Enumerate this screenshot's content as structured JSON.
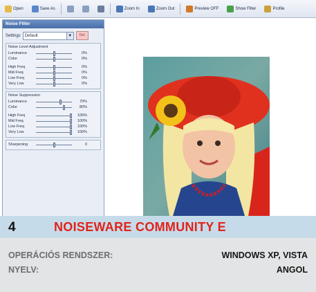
{
  "toolbar": {
    "buttons": [
      {
        "label": "Open",
        "icon": "folder-icon"
      },
      {
        "label": "Save As",
        "icon": "save-icon"
      },
      {
        "label": "",
        "icon": "copy-icon"
      },
      {
        "label": "",
        "icon": "clipboard-icon"
      },
      {
        "label": "",
        "icon": "undo-icon"
      },
      {
        "label": "Zoom In",
        "icon": "zoom-in-icon"
      },
      {
        "label": "Zoom Out",
        "icon": "zoom-out-icon"
      },
      {
        "label": "Preview OFF",
        "icon": "preview-icon"
      },
      {
        "label": "Show Filter",
        "icon": "filter-icon"
      },
      {
        "label": "Profile",
        "icon": "profile-icon"
      }
    ]
  },
  "panel": {
    "title": "Noise Filter",
    "settings_label": "Settings",
    "settings_value": "Default",
    "delete_label": "Del",
    "groups": [
      {
        "title": "Noise Level Adjustment",
        "rows": [
          {
            "label": "Luminance",
            "value": "0%",
            "level": 0.5
          },
          {
            "label": "Color",
            "value": "0%",
            "level": 0.5
          },
          {
            "spacer": true
          },
          {
            "label": "High Freq",
            "value": "0%",
            "level": 0.5
          },
          {
            "label": "Mid Freq",
            "value": "0%",
            "level": 0.5
          },
          {
            "label": "Low Freq",
            "value": "0%",
            "level": 0.5
          },
          {
            "label": "Very Low",
            "value": "0%",
            "level": 0.5
          }
        ]
      },
      {
        "title": "Noise Suppression",
        "rows": [
          {
            "label": "Luminance",
            "value": "70%",
            "level": 0.7
          },
          {
            "label": "Color",
            "value": "80%",
            "level": 0.8
          },
          {
            "spacer": true
          },
          {
            "label": "High Freq",
            "value": "100%",
            "level": 1.0
          },
          {
            "label": "Mid Freq",
            "value": "100%",
            "level": 1.0
          },
          {
            "label": "Low Freq",
            "value": "100%",
            "level": 1.0
          },
          {
            "label": "Very Low",
            "value": "100%",
            "level": 1.0
          }
        ]
      },
      {
        "title": "",
        "rows": [
          {
            "label": "Sharpening",
            "value": "0",
            "level": 0.5
          }
        ]
      }
    ]
  },
  "caption": {
    "number": "4",
    "title": "NOISEWARE COMMUNITY E",
    "rows": [
      {
        "key": "OPERÁCIÓS RENDSZER:",
        "value": "WINDOWS XP, VISTA"
      },
      {
        "key": "NYELV:",
        "value": "ANGOL"
      }
    ]
  },
  "colors": {
    "accent_red": "#e2231a",
    "band_blue": "#c6dbe9",
    "footer_gray": "#e3e4e5"
  }
}
